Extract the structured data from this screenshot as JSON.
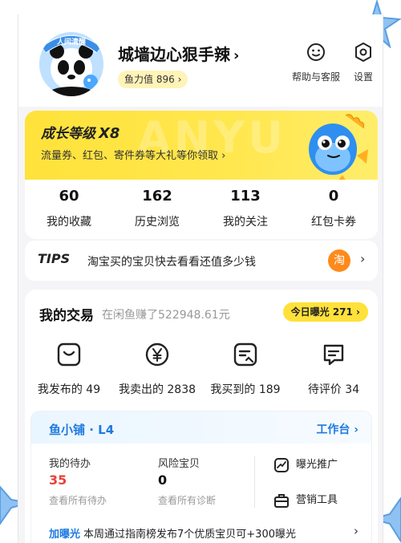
{
  "header": {
    "avatar_badge": "人间清醒",
    "username": "城墙边心狠手辣",
    "username_chevron": "›",
    "charm_label": "鱼力值 896",
    "charm_chevron": "›",
    "help_label": "帮助与客服",
    "settings_label": "设置"
  },
  "level": {
    "title": "成长等级",
    "level_value": "X8",
    "subtitle": "流量券、红包、寄件券等大礼等你领取",
    "subtitle_chevron": "›",
    "bg_text": "ANYU"
  },
  "stats": [
    {
      "num": "60",
      "label": "我的收藏"
    },
    {
      "num": "162",
      "label": "历史浏览"
    },
    {
      "num": "113",
      "label": "我的关注"
    },
    {
      "num": "0",
      "label": "红包卡券"
    }
  ],
  "tips": {
    "logo": "TIPS",
    "text": "淘宝买的宝贝快去看看还值多少钱",
    "app_glyph": "淘",
    "chevron": "›"
  },
  "trade": {
    "title": "我的交易",
    "earnings": "在闲鱼赚了522948.61元",
    "today_badge": "今日曝光 271 ›",
    "items": [
      {
        "label": "我发布的 49",
        "icon": "bag-icon"
      },
      {
        "label": "我卖出的 2838",
        "icon": "yen-coin-icon"
      },
      {
        "label": "我买到的 189",
        "icon": "receipt-icon"
      },
      {
        "label": "待评价 34",
        "icon": "chat-bubble-icon"
      }
    ]
  },
  "shop": {
    "name": "鱼小铺 · L4",
    "workbench": "工作台 ›",
    "todo_title": "我的待办",
    "todo_value": "35",
    "todo_link": "查看所有待办",
    "risk_title": "风险宝贝",
    "risk_value": "0",
    "risk_link": "查看所有诊断",
    "tool1": "曝光推广",
    "tool2": "营销工具",
    "promo_tag": "加曝光",
    "promo_text": "本周通过指南榜发布7个优质宝贝可+300曝光",
    "promo_chevron": "›"
  },
  "colors": {
    "accent_yellow": "#ffe23a",
    "accent_blue": "#1f7ae0",
    "todo_red": "#e8423a"
  }
}
